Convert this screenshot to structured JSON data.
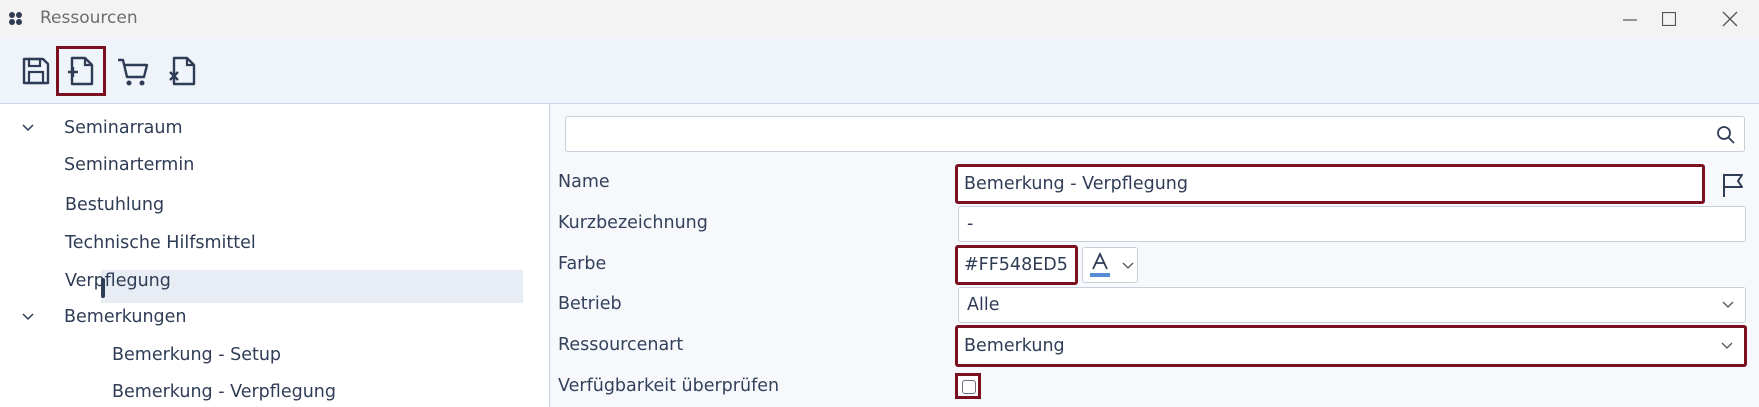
{
  "window": {
    "title": "Ressourcen"
  },
  "toolbar": {
    "buttons": [
      {
        "name": "save",
        "icon": "save-icon"
      },
      {
        "name": "new",
        "icon": "new-document-icon",
        "highlighted": true
      },
      {
        "name": "cart",
        "icon": "cart-icon"
      },
      {
        "name": "delete",
        "icon": "delete-document-icon"
      }
    ]
  },
  "tree": {
    "items": [
      {
        "label": "Seminarraum",
        "expanded": true
      },
      {
        "label": "Seminartermin"
      },
      {
        "label": "Bestuhlung"
      },
      {
        "label": "Technische Hilfsmittel"
      },
      {
        "label": "Verpflegung"
      },
      {
        "label": "Bemerkungen",
        "expanded": true
      },
      {
        "label": "Bemerkung - Setup"
      },
      {
        "label": "Bemerkung - Verpflegung",
        "selected": true
      }
    ]
  },
  "search": {
    "placeholder": "",
    "value": ""
  },
  "form": {
    "name_label": "Name",
    "name_value": "Bemerkung - Verpflegung",
    "kurz_label": "Kurzbezeichnung",
    "kurz_value": "-",
    "farbe_label": "Farbe",
    "farbe_value": "#FF548ED5",
    "betrieb_label": "Betrieb",
    "betrieb_value": "Alle",
    "art_label": "Ressourcenart",
    "art_value": "Bemerkung",
    "check_label": "Verfügbarkeit überprüfen",
    "check_value": false
  },
  "colors": {
    "highlight": "#7a1020",
    "accent": "#548ED5"
  }
}
